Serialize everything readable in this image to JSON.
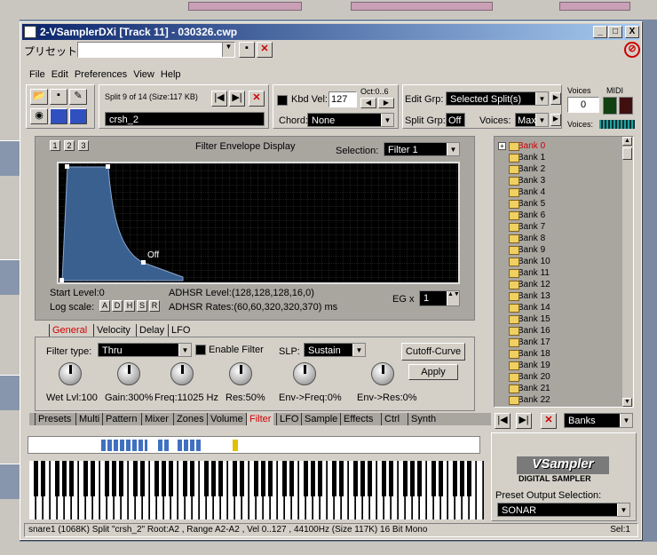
{
  "window": {
    "title": "2-VSamplerDXi [Track 11] - 030326.cwp",
    "min": "_",
    "max": "□",
    "close": "X"
  },
  "preset": {
    "label": "プリセット:",
    "value": ""
  },
  "menu": [
    "File",
    "Edit",
    "Preferences",
    "View",
    "Help"
  ],
  "split": {
    "info": "Split 9 of 14 (Size:117 KB)",
    "name": "crsh_2"
  },
  "kbd": {
    "label": "Kbd Vel:",
    "value": "127",
    "oct": "Oct:0..6",
    "chord_label": "Chord:",
    "chord_value": "None"
  },
  "edit": {
    "grp_label": "Edit Grp:",
    "grp_value": "Selected Split(s)",
    "split_grp_label": "Split Grp:",
    "split_grp_value": "Off",
    "voices_label": "Voices:",
    "voices_value": "Max"
  },
  "voices": {
    "label": "Voices",
    "value": "0",
    "midi": "MIDI",
    "meter": "Voices:"
  },
  "envelope": {
    "title": "Filter Envelope Display",
    "selection_label": "Selection:",
    "selection_value": "Filter 1",
    "tabs": [
      "1",
      "2",
      "3"
    ],
    "off_label": "Off",
    "start_level": "Start Level:0",
    "adhsr_level": "ADHSR Level:(128,128,128,16,0)",
    "log_scale": "Log scale:",
    "log_buttons": [
      "A",
      "D",
      "H",
      "S",
      "R"
    ],
    "adhsr_rates": "ADHSR Rates:(60,60,320,320,370) ms",
    "eg_label": "EG x",
    "eg_value": "1"
  },
  "subtabs": [
    "General",
    "Velocity",
    "Delay",
    "LFO"
  ],
  "filter": {
    "type_label": "Filter type:",
    "type_value": "Thru",
    "enable_label": "Enable Filter",
    "slp_label": "SLP:",
    "slp_value": "Sustain",
    "cutoff_button": "Cutoff-Curve",
    "apply_button": "Apply"
  },
  "knobs": [
    "Wet Lvl:100",
    "Gain:300%",
    "Freq:11025 Hz",
    "Res:50%",
    "Env->Freq:0%",
    "Env->Res:0%"
  ],
  "main_tabs": [
    "Presets",
    "Multi",
    "Pattern",
    "Mixer",
    "Zones",
    "Volume",
    "Filter",
    "LFO",
    "Sample",
    "Effects",
    "Ctrl",
    "Synth"
  ],
  "banks": [
    "Bank 0",
    "Bank 1",
    "Bank 2",
    "Bank 3",
    "Bank 4",
    "Bank 5",
    "Bank 6",
    "Bank 7",
    "Bank 8",
    "Bank 9",
    "Bank 10",
    "Bank 11",
    "Bank 12",
    "Bank 13",
    "Bank 14",
    "Bank 15",
    "Bank 16",
    "Bank 17",
    "Bank 18",
    "Bank 19",
    "Bank 20",
    "Bank 21",
    "Bank 22"
  ],
  "bank_selector": "Banks",
  "logo": {
    "brand": "VSampler",
    "sub": "DIGITAL SAMPLER"
  },
  "output": {
    "label": "Preset Output Selection:",
    "value": "SONAR"
  },
  "status": {
    "text": "snare1 (1068K) Split \"crsh_2\" Root:A2 , Range A2-A2 , Vel 0..127 , 44100Hz (Size 117K) 16 Bit Mono",
    "sel": "Sel:1"
  },
  "colors": {
    "title_start": "#0a246a",
    "title_end": "#a6caf0",
    "envelope_fill": "#3a6090",
    "active_tab": "#d00000"
  }
}
